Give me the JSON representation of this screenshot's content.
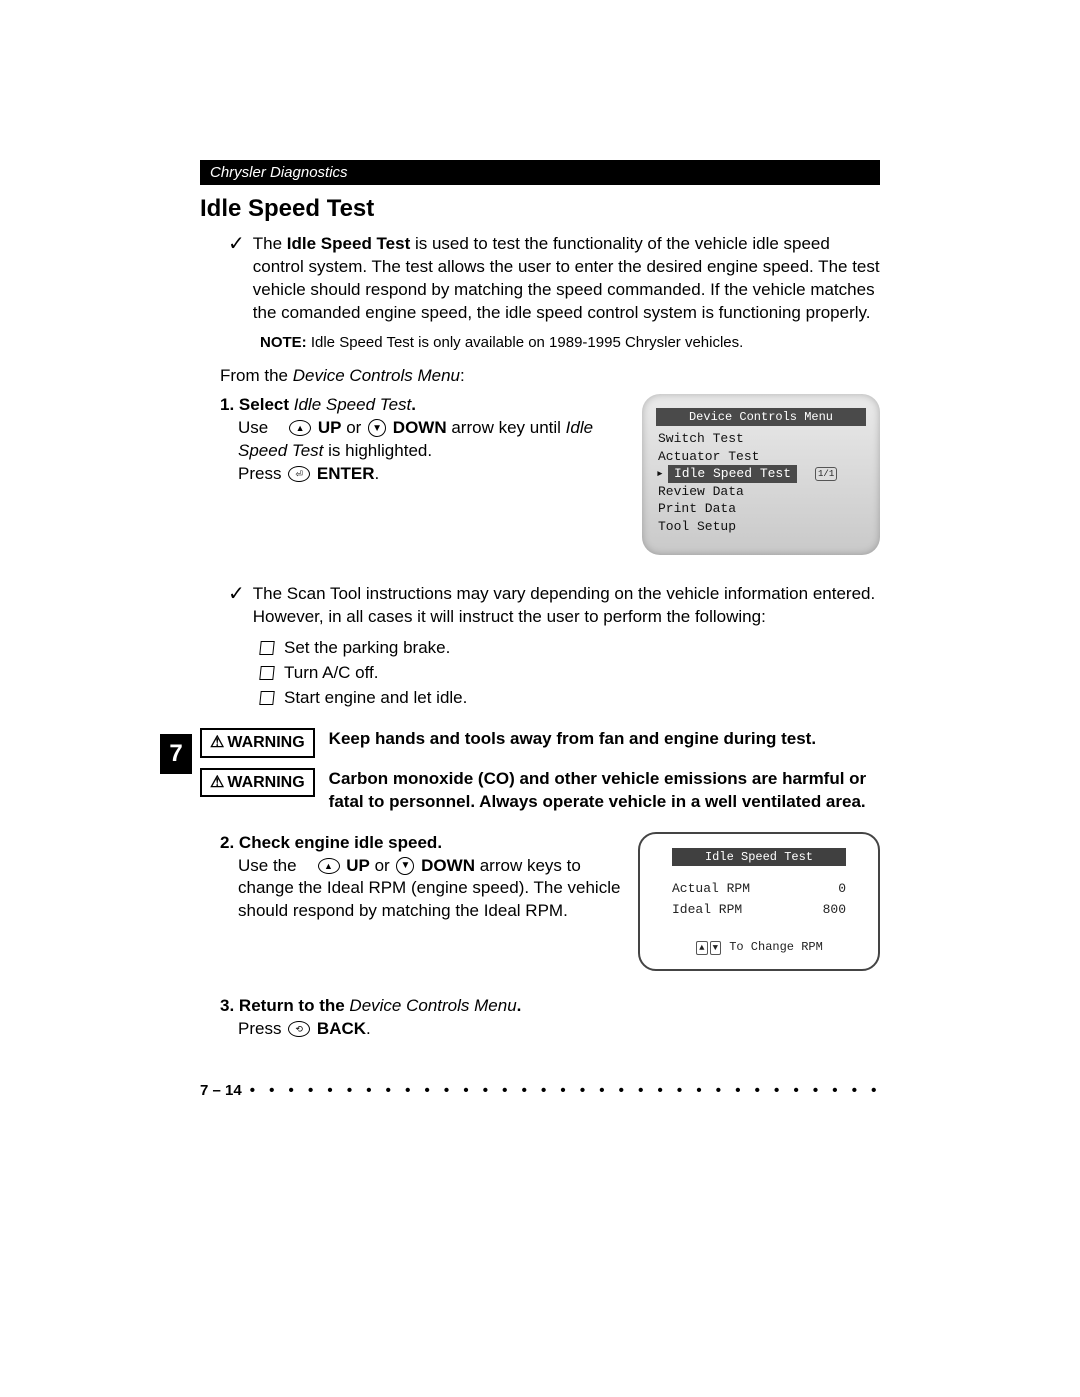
{
  "header": {
    "breadcrumb": "Chrysler Diagnostics"
  },
  "title": "Idle Speed Test",
  "intro": {
    "pre": "The ",
    "bold": "Idle Speed Test",
    "post": " is used to test the functionality of the vehicle idle speed control system. The test allows the user to enter the desired engine speed. The test vehicle should respond by matching the speed commanded. If the vehicle matches the comanded engine speed, the idle speed control system is functioning properly."
  },
  "note": {
    "label": "NOTE:",
    "text": " Idle Speed Test is only available on 1989-1995 Chrysler vehicles."
  },
  "from_line": {
    "pre": "From the ",
    "italic": "Device Controls Menu",
    "post": ":"
  },
  "step1": {
    "num": "1.",
    "select": "Select",
    "select_target": "Idle Speed Test",
    "line2a": "Use",
    "up": "UP",
    "or": " or ",
    "down": "DOWN",
    "line2b": " arrow key until ",
    "line2c": "Idle Speed Test",
    "line2d": " is highlighted.",
    "press": "Press ",
    "enter": "ENTER"
  },
  "screen1": {
    "title": "Device Controls Menu",
    "items": [
      "Switch Test",
      "Actuator Test",
      "Idle Speed Test",
      "Review Data",
      "Print Data",
      "Tool Setup"
    ],
    "selected_index": 2,
    "balloon": "1/1"
  },
  "vary_text": "The Scan Tool instructions may vary depending on the vehicle information entered. However, in all cases it will instruct the user to perform the following:",
  "checklist": [
    "Set the parking brake.",
    "Turn A/C off.",
    "Start engine and let idle."
  ],
  "side_tab": "7",
  "warnings": [
    {
      "label": "WARNING",
      "text": "Keep hands and tools away from fan and engine during test."
    },
    {
      "label": "WARNING",
      "text": "Carbon monoxide CO (and other vehicle emissions are harmful or fatal to personnel. Always operate vehicle in a well ventilated area."
    }
  ],
  "warning_texts": {
    "w1": "Keep hands and tools away from fan and engine during test.",
    "w2": "Carbon monoxide (CO) and other vehicle emissions are harmful or fatal to personnel. Always operate vehicle in a well ventilated area."
  },
  "step2": {
    "num": "2.",
    "heading": "Check engine idle speed.",
    "l1a": "Use the",
    "up": "UP",
    "or": " or ",
    "down": "DOWN",
    "l2": " arrow keys to change the Ideal RPM (engine speed). The vehicle should respond by matching the Ideal RPM."
  },
  "screen2": {
    "title": "Idle Speed Test",
    "rows": [
      {
        "label": "Actual RPM",
        "value": "0"
      },
      {
        "label": "Ideal  RPM",
        "value": "800"
      }
    ],
    "footer": "To Change RPM"
  },
  "step3": {
    "num": "3.",
    "heading_a": "Return to the ",
    "heading_b": "Device Controls Menu",
    "press": "Press ",
    "back": "BACK"
  },
  "page_number": "7 – 14"
}
